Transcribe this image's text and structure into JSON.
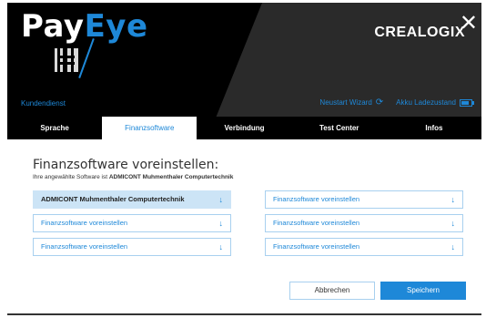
{
  "brand": {
    "logo_pay": "Pay",
    "logo_eye": "Eye",
    "partner": "CREALOGIX"
  },
  "toolbar": {
    "support": "Kundendienst",
    "restart_wizard": "Neustart Wizard",
    "battery": "Akku Ladezustand"
  },
  "tabs": [
    {
      "label": "Sprache"
    },
    {
      "label": "Finanzsoftware"
    },
    {
      "label": "Verbindung"
    },
    {
      "label": "Test Center"
    },
    {
      "label": "Infos"
    }
  ],
  "main": {
    "title": "Finanzsoftware voreinstellen:",
    "subtitle_prefix": "Ihre angewählte Software ist ",
    "subtitle_value": "ADMICONT Muhmenthaler Computertechnik",
    "selects": [
      {
        "value": "ADMICONT Muhmenthaler Computertechnik",
        "selected": true
      },
      {
        "value": "Finanzsoftware voreinstellen"
      },
      {
        "value": "Finanzsoftware voreinstellen"
      },
      {
        "value": "Finanzsoftware voreinstellen"
      },
      {
        "value": "Finanzsoftware voreinstellen"
      },
      {
        "value": "Finanzsoftware voreinstellen"
      }
    ],
    "arrow_glyph": "↓"
  },
  "buttons": {
    "cancel": "Abbrechen",
    "save": "Speichern"
  },
  "colors": {
    "accent": "#1e88d8",
    "selected_bg": "#cce4f6",
    "header_bg": "#000000"
  }
}
